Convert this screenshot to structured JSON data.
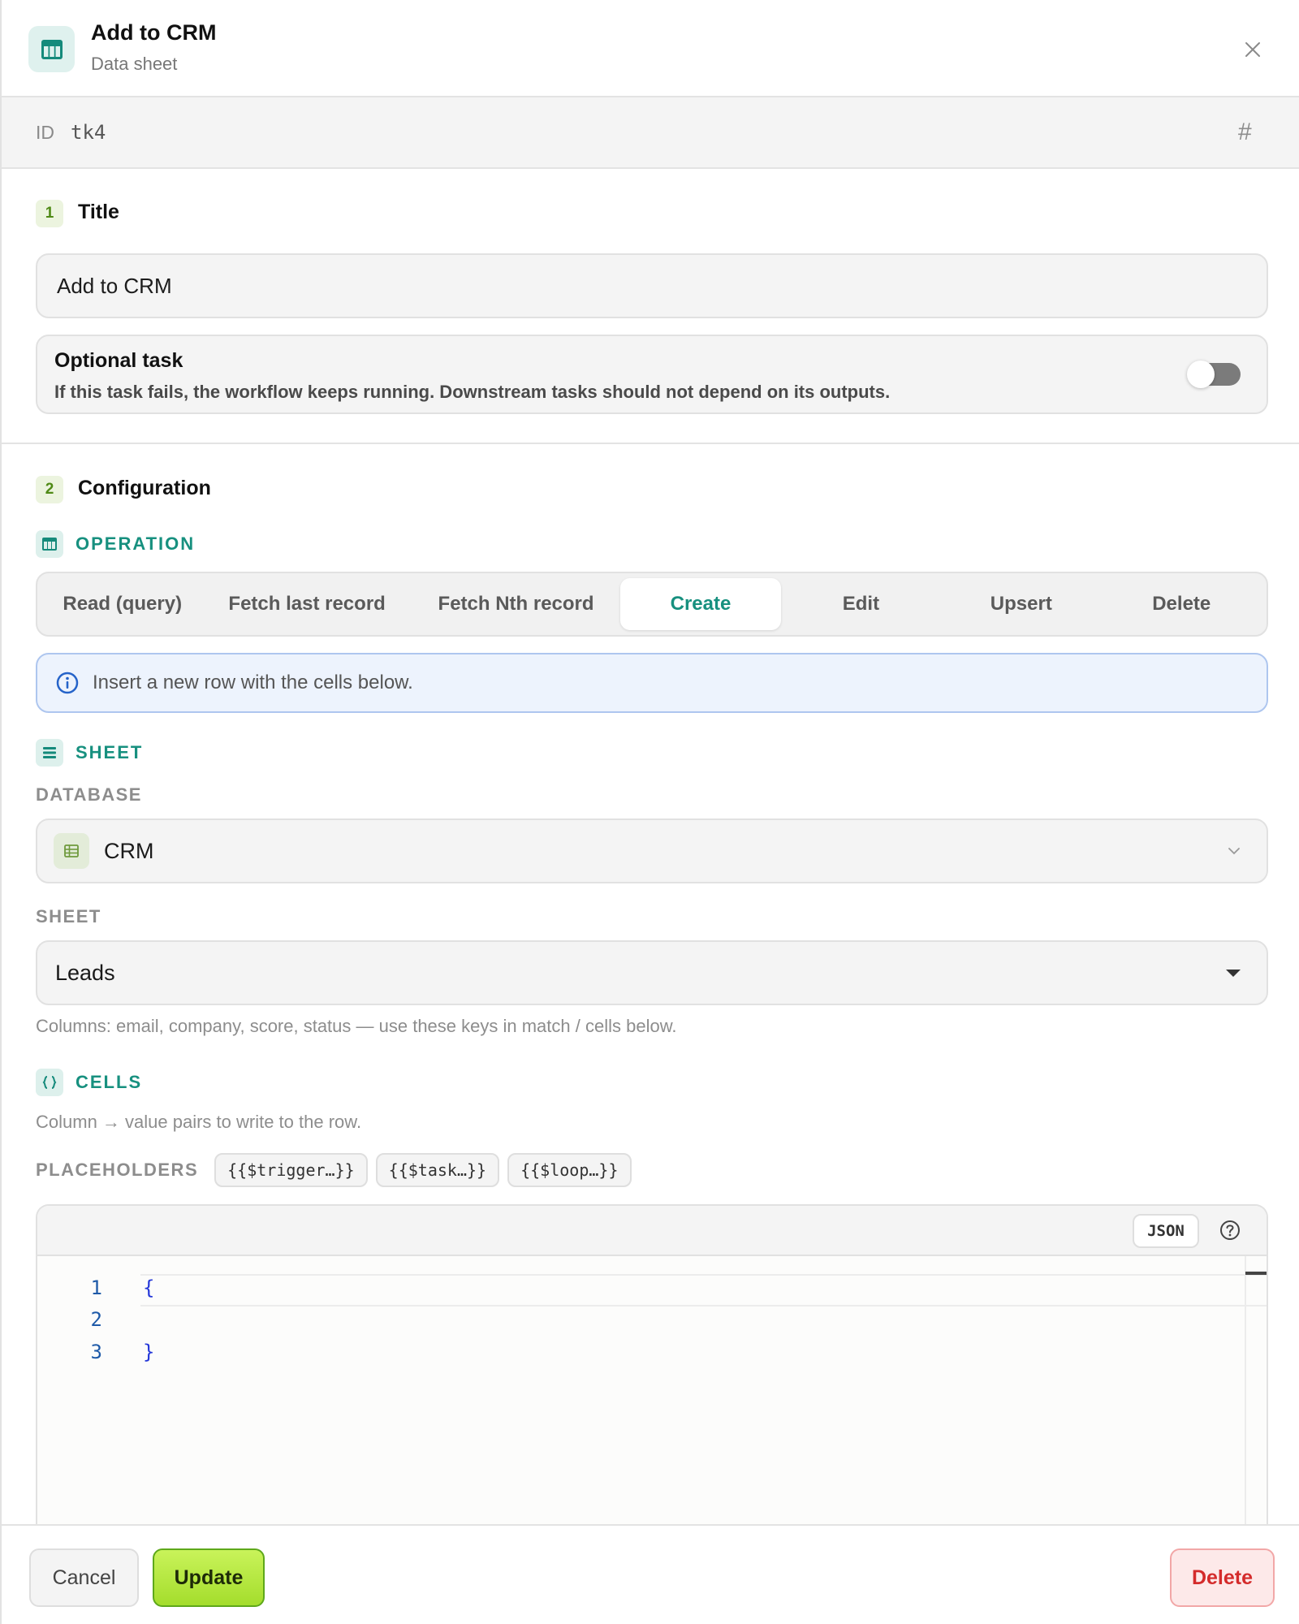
{
  "header": {
    "title": "Add to CRM",
    "subtitle": "Data sheet",
    "icon": "table-icon",
    "close_icon": "close-icon"
  },
  "id_row": {
    "label": "ID",
    "value": "tk4",
    "icon": "hash-icon"
  },
  "section1": {
    "number": "1",
    "title": "Title"
  },
  "title_field": {
    "value": "Add to CRM"
  },
  "optional_task": {
    "title": "Optional task",
    "description": "If this task fails, the workflow keeps running. Downstream tasks should not depend on its outputs.",
    "enabled": false
  },
  "section2": {
    "number": "2",
    "title": "Configuration"
  },
  "operation": {
    "label": "OPERATION",
    "options": [
      {
        "label": "Read (query)"
      },
      {
        "label": "Fetch last record"
      },
      {
        "label": "Fetch Nth record"
      },
      {
        "label": "Create"
      },
      {
        "label": "Edit"
      },
      {
        "label": "Upsert"
      },
      {
        "label": "Delete"
      }
    ],
    "selected": "Create"
  },
  "info": {
    "text": "Insert a new row with the cells below."
  },
  "sheet_section": {
    "label": "SHEET"
  },
  "database": {
    "label": "DATABASE",
    "value": "CRM"
  },
  "sheet": {
    "label": "SHEET",
    "value": "Leads",
    "hint": "Columns: email, company, score, status — use these keys in match / cells below."
  },
  "cells": {
    "label": "CELLS",
    "hint": "Column → value pairs to write to the row.",
    "placeholders_label": "PLACEHOLDERS",
    "placeholders": [
      "{{$trigger…}}",
      "{{$task…}}",
      "{{$loop…}}"
    ]
  },
  "editor": {
    "format_badge": "JSON",
    "lines": [
      {
        "num": "1",
        "code": "{"
      },
      {
        "num": "2",
        "code": ""
      },
      {
        "num": "3",
        "code": "}"
      }
    ]
  },
  "footer": {
    "cancel_label": "Cancel",
    "update_label": "Update",
    "delete_label": "Delete"
  },
  "colors": {
    "accent_teal": "#17907f",
    "update_green": "#b6e843",
    "delete_red": "#d42b2b",
    "info_blue": "#2563c9"
  }
}
